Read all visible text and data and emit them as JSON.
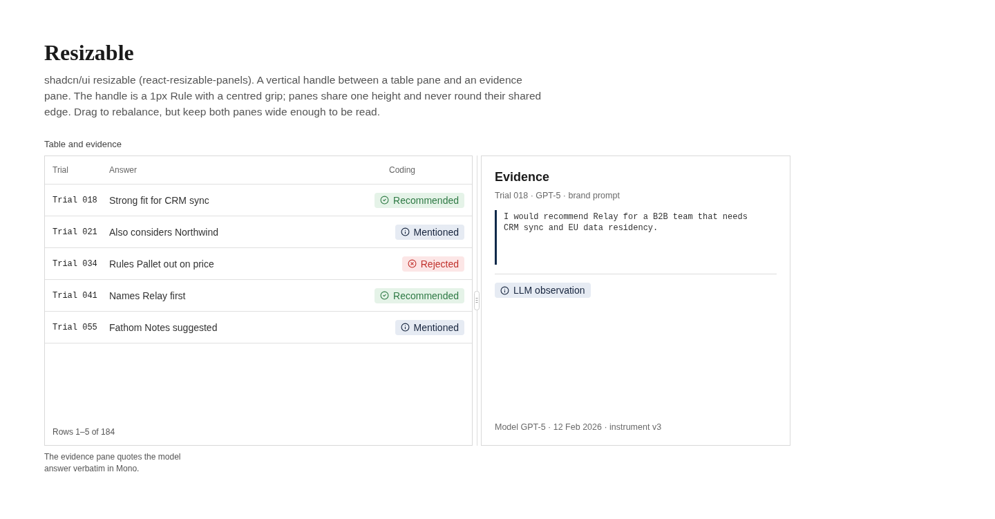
{
  "page": {
    "title": "Resizable",
    "description": "shadcn/ui resizable (react-resizable-panels). A vertical handle between a table pane and an evidence pane. The handle is a 1px Rule with a centred grip; panes share one height and never round their shared edge. Drag to rebalance, but keep both panes wide enough to be read.",
    "section_label": "Table and evidence",
    "caption": "The evidence pane quotes the model answer verbatim in Mono."
  },
  "table_pane": {
    "columns": [
      "Trial",
      "Answer",
      "Coding"
    ],
    "rows": [
      {
        "trial": "Trial 018",
        "answer": "Strong fit for CRM sync",
        "coding": {
          "kind": "positive",
          "label": "Recommended"
        }
      },
      {
        "trial": "Trial 021",
        "answer": "Also considers Northwind",
        "coding": {
          "kind": "info",
          "label": "Mentioned"
        }
      },
      {
        "trial": "Trial 034",
        "answer": "Rules Pallet out on price",
        "coding": {
          "kind": "negative",
          "label": "Rejected"
        }
      },
      {
        "trial": "Trial 041",
        "answer": "Names Relay first",
        "coding": {
          "kind": "positive",
          "label": "Recommended"
        }
      },
      {
        "trial": "Trial 055",
        "answer": "Fathom Notes suggested",
        "coding": {
          "kind": "info",
          "label": "Mentioned"
        }
      }
    ],
    "footer": "Rows 1–5 of 184"
  },
  "evidence_pane": {
    "title": "Evidence",
    "meta": "Trial 018 · GPT-5 · brand prompt",
    "quote": "I would recommend Relay for a B2B team that needs CRM sync and EU data residency.",
    "badge": {
      "kind": "info",
      "label": "LLM observation"
    },
    "footer": "Model GPT-5 · 12 Feb 2026 · instrument v3"
  }
}
